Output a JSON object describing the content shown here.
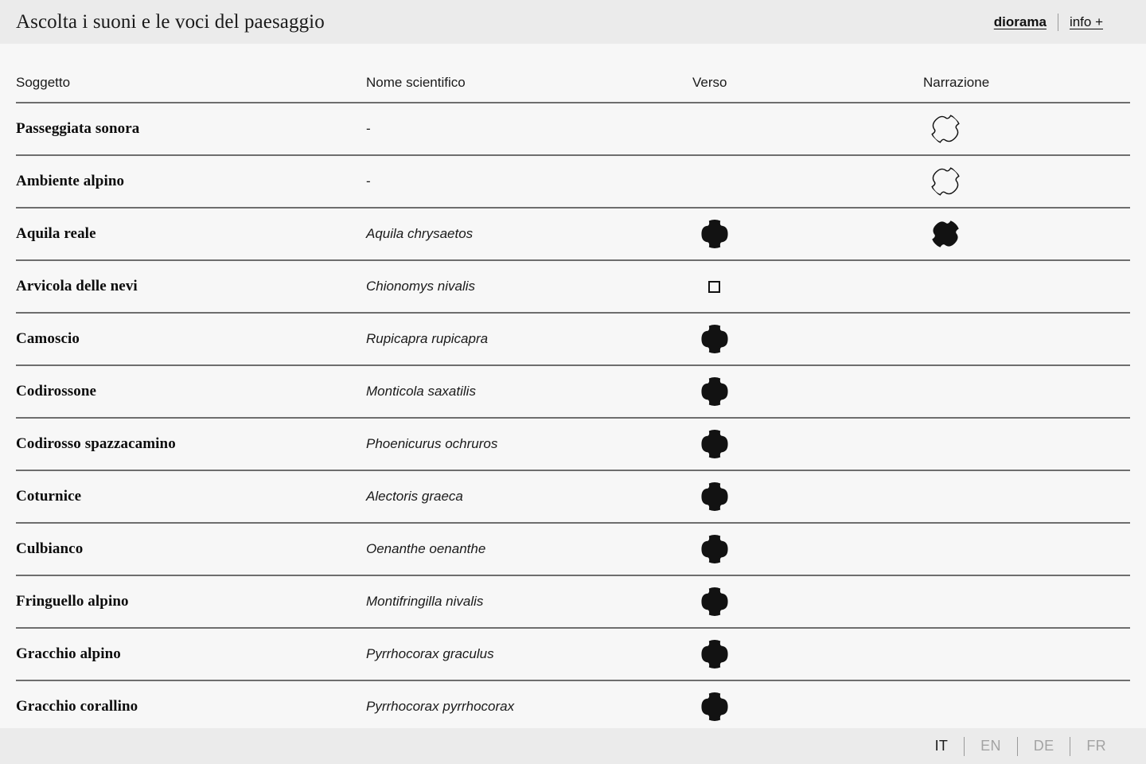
{
  "header": {
    "title": "Ascolta i suoni e le voci del paesaggio",
    "links": [
      {
        "label": "diorama",
        "bold": true
      },
      {
        "label": "info +",
        "bold": false
      }
    ]
  },
  "table": {
    "columns": [
      "Soggetto",
      "Nome scientifico",
      "Verso",
      "Narrazione"
    ],
    "rows": [
      {
        "subject": "Passeggiata sonora",
        "scientific": "-",
        "verso": "none",
        "narration": "blob-outline"
      },
      {
        "subject": "Ambiente alpino",
        "scientific": "-",
        "verso": "none",
        "narration": "blob-outline"
      },
      {
        "subject": "Aquila reale",
        "scientific": "Aquila chrysaetos",
        "verso": "blob-filled",
        "narration": "blob-filled"
      },
      {
        "subject": "Arvicola delle nevi",
        "scientific": "Chionomys nivalis",
        "verso": "square-outline",
        "narration": "none"
      },
      {
        "subject": "Camoscio",
        "scientific": "Rupicapra rupicapra",
        "verso": "blob-filled",
        "narration": "none"
      },
      {
        "subject": "Codirossone",
        "scientific": "Monticola saxatilis",
        "verso": "blob-filled",
        "narration": "none"
      },
      {
        "subject": "Codirosso spazzacamino",
        "scientific": "Phoenicurus ochruros",
        "verso": "blob-filled",
        "narration": "none"
      },
      {
        "subject": "Coturnice",
        "scientific": "Alectoris graeca",
        "verso": "blob-filled",
        "narration": "none"
      },
      {
        "subject": "Culbianco",
        "scientific": "Oenanthe oenanthe",
        "verso": "blob-filled",
        "narration": "none"
      },
      {
        "subject": "Fringuello alpino",
        "scientific": "Montifringilla nivalis",
        "verso": "blob-filled",
        "narration": "none"
      },
      {
        "subject": "Gracchio alpino",
        "scientific": "Pyrrhocorax graculus",
        "verso": "blob-filled",
        "narration": "none"
      },
      {
        "subject": "Gracchio corallino",
        "scientific": "Pyrrhocorax pyrrhocorax",
        "verso": "blob-filled",
        "narration": "none"
      }
    ]
  },
  "footer": {
    "languages": [
      {
        "code": "IT",
        "active": true
      },
      {
        "code": "EN",
        "active": false
      },
      {
        "code": "DE",
        "active": false
      },
      {
        "code": "FR",
        "active": false
      }
    ]
  },
  "colors": {
    "bar_background": "#ebebeb",
    "page_background": "#f7f7f7",
    "rule": "#6e6e6e",
    "text": "#1a1a1a",
    "muted_text": "#a3a3a3",
    "icon": "#121212"
  }
}
